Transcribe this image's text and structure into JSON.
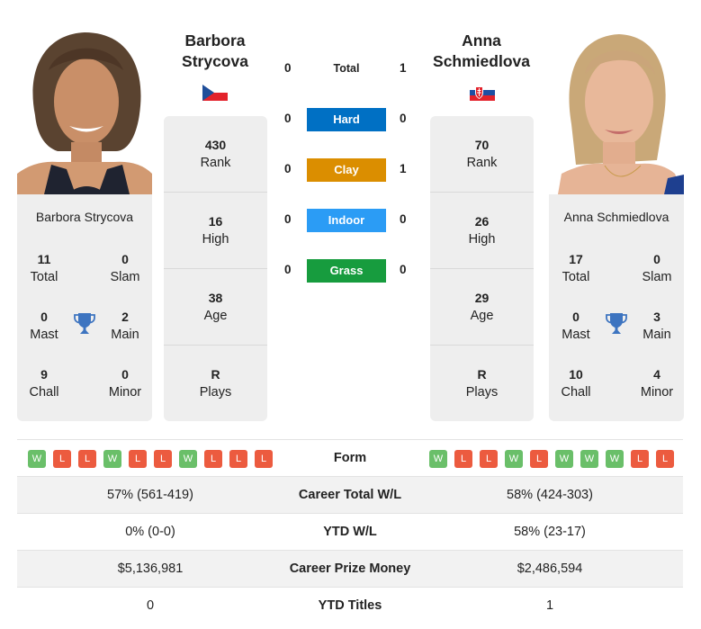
{
  "colors": {
    "hard": "#0070c4",
    "clay": "#db8e00",
    "indoor": "#2b9cf5",
    "grass": "#179c3e",
    "win": "#6abf69",
    "loss": "#ec5b3f",
    "trophy": "#3d74c0"
  },
  "player1": {
    "name_line1": "Barbora",
    "name_line2": "Strycova",
    "full_name": "Barbora Strycova",
    "flag": "czech-republic-flag",
    "rank": {
      "value": "430",
      "label": "Rank"
    },
    "high": {
      "value": "16",
      "label": "High"
    },
    "age": {
      "value": "38",
      "label": "Age"
    },
    "plays": {
      "value": "R",
      "label": "Plays"
    },
    "titles": {
      "total": {
        "value": "11",
        "label": "Total"
      },
      "slam": {
        "value": "0",
        "label": "Slam"
      },
      "mast": {
        "value": "0",
        "label": "Mast"
      },
      "main": {
        "value": "2",
        "label": "Main"
      },
      "chall": {
        "value": "9",
        "label": "Chall"
      },
      "minor": {
        "value": "0",
        "label": "Minor"
      }
    },
    "form": [
      "W",
      "L",
      "L",
      "W",
      "L",
      "L",
      "W",
      "L",
      "L",
      "L"
    ],
    "career_wl": "57% (561-419)",
    "ytd_wl": "0% (0-0)",
    "prize_money": "$5,136,981",
    "ytd_titles": "0"
  },
  "player2": {
    "name_line1": "Anna",
    "name_line2": "Schmiedlova",
    "full_name": "Anna Schmiedlova",
    "flag": "slovakia-flag",
    "rank": {
      "value": "70",
      "label": "Rank"
    },
    "high": {
      "value": "26",
      "label": "High"
    },
    "age": {
      "value": "29",
      "label": "Age"
    },
    "plays": {
      "value": "R",
      "label": "Plays"
    },
    "titles": {
      "total": {
        "value": "17",
        "label": "Total"
      },
      "slam": {
        "value": "0",
        "label": "Slam"
      },
      "mast": {
        "value": "0",
        "label": "Mast"
      },
      "main": {
        "value": "3",
        "label": "Main"
      },
      "chall": {
        "value": "10",
        "label": "Chall"
      },
      "minor": {
        "value": "4",
        "label": "Minor"
      }
    },
    "form": [
      "W",
      "L",
      "L",
      "W",
      "L",
      "W",
      "W",
      "W",
      "L",
      "L"
    ],
    "career_wl": "58% (424-303)",
    "ytd_wl": "58% (23-17)",
    "prize_money": "$2,486,594",
    "ytd_titles": "1"
  },
  "h2h": [
    {
      "label": "Total",
      "p1": "0",
      "p2": "1",
      "surface": null
    },
    {
      "label": "Hard",
      "p1": "0",
      "p2": "0",
      "surface": "hard"
    },
    {
      "label": "Clay",
      "p1": "0",
      "p2": "1",
      "surface": "clay"
    },
    {
      "label": "Indoor",
      "p1": "0",
      "p2": "0",
      "surface": "indoor"
    },
    {
      "label": "Grass",
      "p1": "0",
      "p2": "0",
      "surface": "grass"
    }
  ],
  "stats_labels": {
    "form": "Form",
    "career_wl": "Career Total W/L",
    "ytd_wl": "YTD W/L",
    "prize_money": "Career Prize Money",
    "ytd_titles": "YTD Titles"
  }
}
